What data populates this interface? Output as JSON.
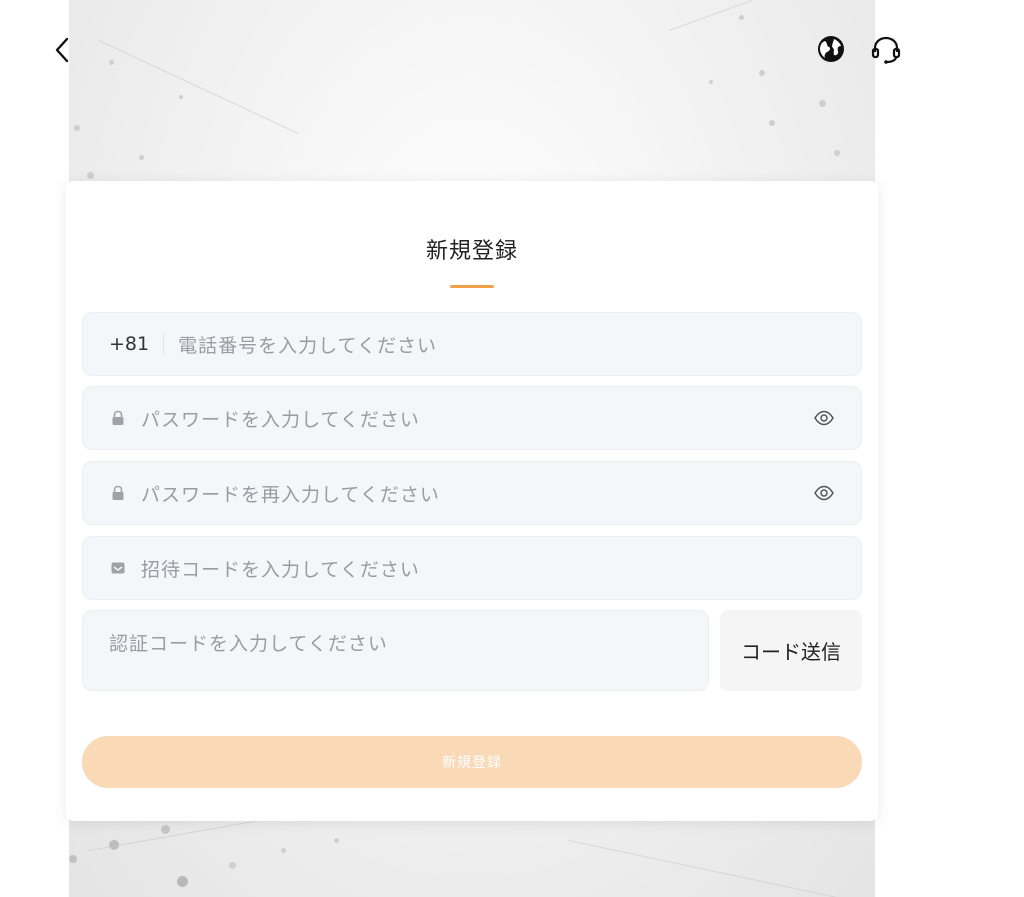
{
  "header": {
    "back_icon": "chevron-left-icon",
    "language_icon": "globe-icon",
    "support_icon": "headset-icon"
  },
  "form": {
    "title": "新規登録",
    "accent_color": "#f0a04b",
    "phone": {
      "country_code": "+81",
      "placeholder": "電話番号を入力してください"
    },
    "password": {
      "icon": "lock-icon",
      "placeholder": "パスワードを入力してください",
      "toggle_icon": "eye-icon"
    },
    "password_confirm": {
      "icon": "lock-icon",
      "placeholder": "パスワードを再入力してください",
      "toggle_icon": "eye-icon"
    },
    "invite_code": {
      "icon": "envelope-icon",
      "placeholder": "招待コードを入力してください"
    },
    "verification_code": {
      "placeholder": "認証コードを入力してください",
      "send_label": "コード送信"
    },
    "submit": {
      "label": "新規登録",
      "color": "#f9d9b6"
    }
  }
}
